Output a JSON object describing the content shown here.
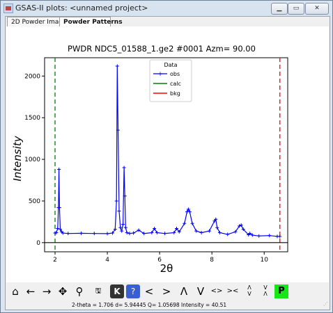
{
  "window": {
    "title": "GSAS-II plots: <unnamed project>"
  },
  "tabs": [
    {
      "label": "2D Powder Image",
      "active": false
    },
    {
      "label": "Powder Patterns",
      "active": true
    }
  ],
  "chart_data": {
    "type": "line",
    "title": "PWDR NDC5_01588_1.ge2 #0001 Azm= 90.00",
    "xlabel": "2θ",
    "ylabel": "Intensity",
    "xlim": [
      1.6,
      10.9
    ],
    "ylim": [
      -110,
      2220
    ],
    "x_ticks": [
      "2",
      "4",
      "6",
      "8",
      "10"
    ],
    "y_ticks": [
      "0",
      "500",
      "1000",
      "1500",
      "2000"
    ],
    "legend": {
      "title": "Data",
      "placement": "top-center",
      "entries": [
        "obs",
        "calc",
        "bkg"
      ]
    },
    "series": [
      {
        "name": "obs",
        "color": "#0000ff",
        "marker": "+",
        "x": [
          2.0,
          2.05,
          2.1,
          2.13,
          2.15,
          2.17,
          2.2,
          2.25,
          2.3,
          2.5,
          3.0,
          3.5,
          4.0,
          4.2,
          4.3,
          4.35,
          4.38,
          4.41,
          4.45,
          4.5,
          4.55,
          4.6,
          4.64,
          4.67,
          4.7,
          4.75,
          4.85,
          5.0,
          5.2,
          5.4,
          5.7,
          5.8,
          5.9,
          6.2,
          6.55,
          6.65,
          6.75,
          6.95,
          7.05,
          7.1,
          7.15,
          7.25,
          7.4,
          7.6,
          7.9,
          8.1,
          8.15,
          8.2,
          8.3,
          8.6,
          8.9,
          9.05,
          9.12,
          9.2,
          9.4,
          9.45,
          9.55,
          9.8,
          10.2,
          10.5,
          10.6
        ],
        "y": [
          115,
          120,
          170,
          420,
          880,
          420,
          160,
          130,
          115,
          110,
          112,
          110,
          108,
          115,
          160,
          500,
          2120,
          1350,
          380,
          180,
          140,
          220,
          900,
          560,
          180,
          120,
          110,
          115,
          150,
          110,
          120,
          170,
          120,
          110,
          120,
          170,
          130,
          230,
          370,
          400,
          370,
          230,
          140,
          120,
          140,
          260,
          280,
          180,
          120,
          100,
          130,
          200,
          210,
          160,
          95,
          110,
          90,
          80,
          85,
          75,
          75
        ]
      },
      {
        "name": "calc",
        "color": "#008000",
        "type": "vline",
        "x": 2.0
      },
      {
        "name": "bkg",
        "color": "#ff0000",
        "type": "vline",
        "x": 10.6
      }
    ],
    "zero_line": 0
  },
  "toolbar": {
    "buttons": [
      {
        "name": "home-button",
        "glyph": "⌂"
      },
      {
        "name": "back-button",
        "glyph": "←"
      },
      {
        "name": "forward-button",
        "glyph": "→"
      },
      {
        "name": "pan-button",
        "glyph": "✥"
      },
      {
        "name": "zoom-button",
        "glyph": "⚲"
      },
      {
        "name": "save-button",
        "glyph": "🖫"
      },
      {
        "name": "key-help-button",
        "glyph": "K"
      },
      {
        "name": "help-button",
        "glyph": "?"
      },
      {
        "name": "shift-left-button",
        "glyph": "<"
      },
      {
        "name": "shift-right-button",
        "glyph": ">"
      },
      {
        "name": "shift-up-button",
        "glyph": "Λ"
      },
      {
        "name": "shift-down-button",
        "glyph": "V"
      },
      {
        "name": "expand-x-button",
        "glyph": "<>"
      },
      {
        "name": "shrink-x-button",
        "glyph": "><"
      },
      {
        "name": "expand-y-button",
        "glyph": "Λ\nV"
      },
      {
        "name": "shrink-y-button",
        "glyph": "V\nΛ"
      },
      {
        "name": "publish-button",
        "glyph": "P"
      }
    ]
  },
  "status": {
    "text": "2-theta =    1.706 d=  5.94445 Q=  1.05698 Intensity =     40.51"
  }
}
